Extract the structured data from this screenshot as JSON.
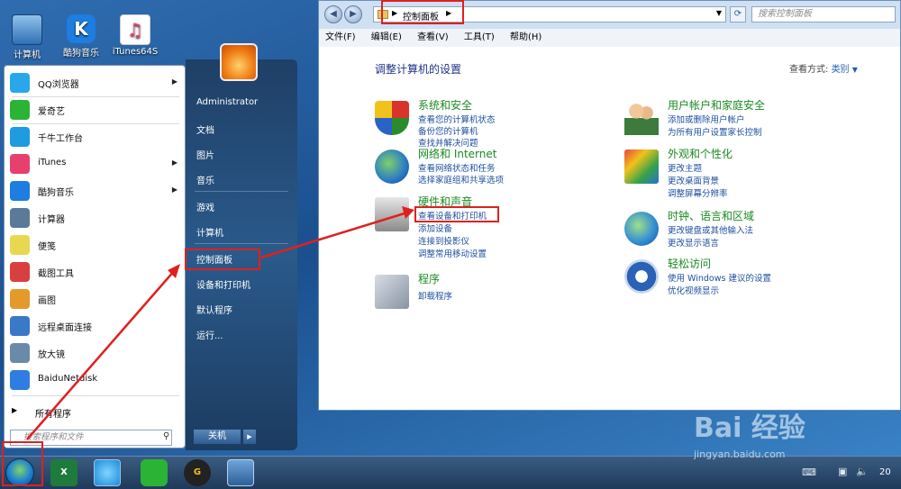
{
  "desktop": {
    "icons": [
      "计算机",
      "酷狗音乐",
      "iTunes64S"
    ]
  },
  "window": {
    "address_path": "控制面板",
    "search_placeholder": "搜索控制面板",
    "menu": [
      "文件(F)",
      "编辑(E)",
      "查看(V)",
      "工具(T)",
      "帮助(H)"
    ],
    "heading": "调整计算机的设置",
    "view_by_label": "查看方式:",
    "view_by_value": "类别",
    "categories_left": [
      {
        "title": "系统和安全",
        "links": [
          "查看您的计算机状态",
          "备份您的计算机",
          "查找并解决问题"
        ],
        "icon": "shield-icon"
      },
      {
        "title": "网络和 Internet",
        "links": [
          "查看网络状态和任务",
          "选择家庭组和共享选项"
        ],
        "icon": "network-icon"
      },
      {
        "title": "硬件和声音",
        "links": [
          "查看设备和打印机",
          "添加设备",
          "连接到投影仪",
          "调整常用移动设置"
        ],
        "icon": "printer-icon"
      },
      {
        "title": "程序",
        "links": [
          "卸载程序"
        ],
        "icon": "programs-icon"
      }
    ],
    "categories_right": [
      {
        "title": "用户帐户和家庭安全",
        "links": [
          "添加或删除用户帐户",
          "为所有用户设置家长控制"
        ],
        "icon": "users-icon"
      },
      {
        "title": "外观和个性化",
        "links": [
          "更改主题",
          "更改桌面背景",
          "调整屏幕分辨率"
        ],
        "icon": "appearance-icon"
      },
      {
        "title": "时钟、语言和区域",
        "links": [
          "更改键盘或其他输入法",
          "更改显示语言"
        ],
        "icon": "globe-clock-icon"
      },
      {
        "title": "轻松访问",
        "links": [
          "使用 Windows 建议的设置",
          "优化视频显示"
        ],
        "icon": "accessibility-icon"
      }
    ]
  },
  "start_menu": {
    "apps": [
      {
        "label": "QQ浏览器",
        "color": "#2aa7e8",
        "arrow": true
      },
      {
        "label": "爱奇艺",
        "color": "#2bb335",
        "arrow": false
      },
      {
        "label": "千牛工作台",
        "color": "#1f9be0",
        "arrow": false
      },
      {
        "label": "iTunes",
        "color": "#e7406d",
        "arrow": true
      },
      {
        "label": "酷狗音乐",
        "color": "#1d7de0",
        "arrow": true
      },
      {
        "label": "计算器",
        "color": "#5a7a9a",
        "arrow": false
      },
      {
        "label": "便笺",
        "color": "#e8d850",
        "arrow": false
      },
      {
        "label": "截图工具",
        "color": "#d84040",
        "arrow": false
      },
      {
        "label": "画图",
        "color": "#e49a2a",
        "arrow": false
      },
      {
        "label": "远程桌面连接",
        "color": "#3a78c8",
        "arrow": false
      },
      {
        "label": "放大镜",
        "color": "#6a8aaa",
        "arrow": false
      },
      {
        "label": "BaiduNetdisk",
        "color": "#2f7de1",
        "arrow": false
      }
    ],
    "all_programs": "所有程序",
    "search_placeholder": "搜索程序和文件",
    "right_items": [
      "Administrator",
      "文档",
      "图片",
      "音乐",
      "游戏",
      "计算机",
      "控制面板",
      "设备和打印机",
      "默认程序",
      "运行..."
    ],
    "shutdown_label": "关机"
  },
  "taskbar": {
    "clock_partial": "20"
  },
  "watermark": {
    "main": "Bai 经验",
    "sub": "jingyan.baidu.com"
  }
}
